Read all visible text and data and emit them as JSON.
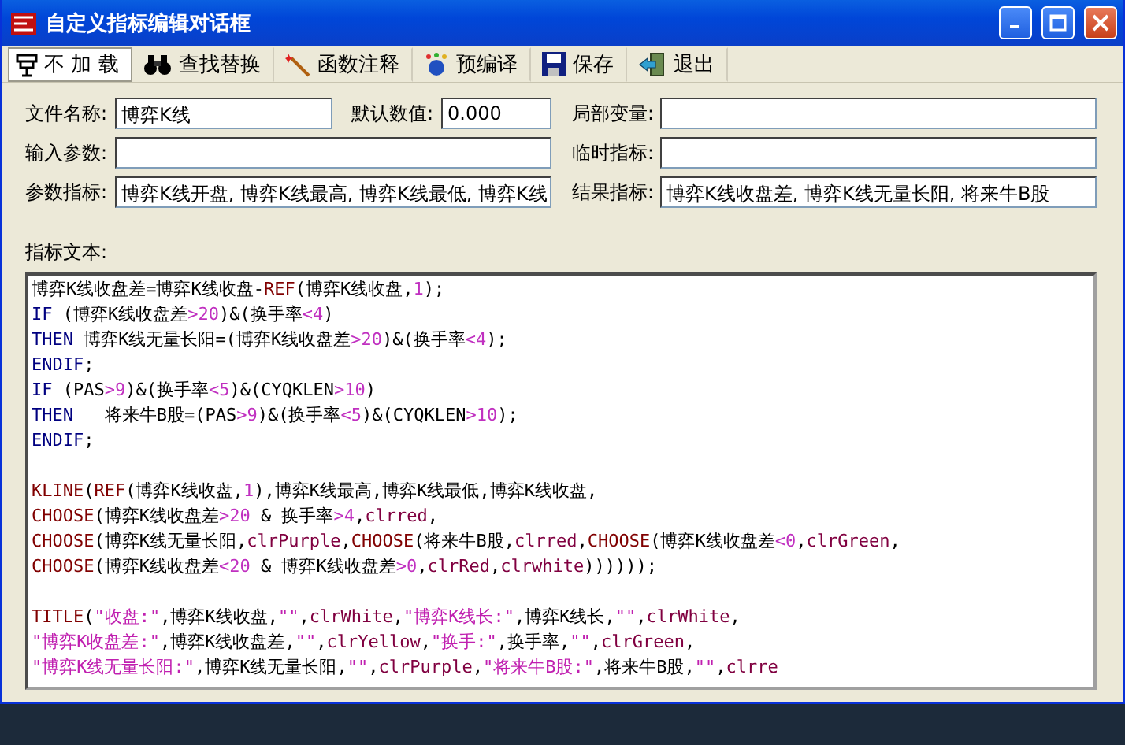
{
  "window": {
    "title": "自定义指标编辑对话框"
  },
  "toolbar": [
    {
      "label": "不 加 载",
      "pressed": true
    },
    {
      "label": "查找替换",
      "pressed": false
    },
    {
      "label": "函数注释",
      "pressed": false
    },
    {
      "label": "预编译",
      "pressed": false
    },
    {
      "label": "保存",
      "pressed": false
    },
    {
      "label": "退出",
      "pressed": false
    }
  ],
  "fields": {
    "file_name": {
      "label": "文件名称:",
      "value": "博弈K线"
    },
    "default_value": {
      "label": "默认数值:",
      "value": "0.000"
    },
    "local_vars": {
      "label": "局部变量:"
    },
    "input_params": {
      "label": "输入参数:"
    },
    "temp_indicators": {
      "label": "临时指标:"
    },
    "param_indicators": {
      "label": "参数指标:",
      "value": "博弈K线开盘, 博弈K线最高, 博弈K线最低, 博弈K线"
    },
    "result_indicators": {
      "label": "结果指标:",
      "value": "博弈K线收盘差, 博弈K线无量长阳, 将来牛B股"
    }
  },
  "editor": {
    "label": "指标文本:",
    "lines": [
      {
        "kind": "code",
        "segments": [
          {
            "kind": "text",
            "text": "博弈K线收盘差=博弈K线收盘-"
          },
          {
            "kind": "fn",
            "text": "REF"
          },
          {
            "kind": "text",
            "text": "(博弈K线收盘,"
          },
          {
            "kind": "num",
            "text": "1"
          },
          {
            "kind": "text",
            "text": ");"
          }
        ]
      },
      {
        "kind": "code",
        "segments": [
          {
            "kind": "kw",
            "text": "IF"
          },
          {
            "kind": "text",
            "text": " (博弈K线收盘差"
          },
          {
            "kind": "num",
            "text": ">20"
          },
          {
            "kind": "text",
            "text": ")&(换手率"
          },
          {
            "kind": "num",
            "text": "<4"
          },
          {
            "kind": "text",
            "text": ")"
          }
        ]
      },
      {
        "kind": "code",
        "segments": [
          {
            "kind": "kw",
            "text": "THEN"
          },
          {
            "kind": "text",
            "text": " 博弈K线无量长阳=(博弈K线收盘差"
          },
          {
            "kind": "num",
            "text": ">20"
          },
          {
            "kind": "text",
            "text": ")&(换手率"
          },
          {
            "kind": "num",
            "text": "<4"
          },
          {
            "kind": "text",
            "text": ");"
          }
        ]
      },
      {
        "kind": "code",
        "segments": [
          {
            "kind": "kw",
            "text": "ENDIF"
          },
          {
            "kind": "text",
            "text": ";"
          }
        ]
      },
      {
        "kind": "code",
        "segments": [
          {
            "kind": "kw",
            "text": "IF"
          },
          {
            "kind": "text",
            "text": " (PAS"
          },
          {
            "kind": "num",
            "text": ">9"
          },
          {
            "kind": "text",
            "text": ")&(换手率"
          },
          {
            "kind": "num",
            "text": "<5"
          },
          {
            "kind": "text",
            "text": ")&(CYQKLEN"
          },
          {
            "kind": "num",
            "text": ">10"
          },
          {
            "kind": "text",
            "text": ")"
          }
        ]
      },
      {
        "kind": "code",
        "segments": [
          {
            "kind": "kw",
            "text": "THEN"
          },
          {
            "kind": "text",
            "text": "   将来牛B股=(PAS"
          },
          {
            "kind": "num",
            "text": ">9"
          },
          {
            "kind": "text",
            "text": ")&(换手率"
          },
          {
            "kind": "num",
            "text": "<5"
          },
          {
            "kind": "text",
            "text": ")&(CYQKLEN"
          },
          {
            "kind": "num",
            "text": ">10"
          },
          {
            "kind": "text",
            "text": ");"
          }
        ]
      },
      {
        "kind": "code",
        "segments": [
          {
            "kind": "kw",
            "text": "ENDIF"
          },
          {
            "kind": "text",
            "text": ";"
          }
        ]
      },
      {
        "kind": "blank"
      },
      {
        "kind": "code",
        "segments": [
          {
            "kind": "fn",
            "text": "KLINE"
          },
          {
            "kind": "text",
            "text": "("
          },
          {
            "kind": "fn",
            "text": "REF"
          },
          {
            "kind": "text",
            "text": "(博弈K线收盘,"
          },
          {
            "kind": "num",
            "text": "1"
          },
          {
            "kind": "text",
            "text": "),博弈K线最高,博弈K线最低,博弈K线收盘,"
          }
        ]
      },
      {
        "kind": "code",
        "segments": [
          {
            "kind": "fn",
            "text": "CHOOSE"
          },
          {
            "kind": "text",
            "text": "(博弈K线收盘差"
          },
          {
            "kind": "num",
            "text": ">20"
          },
          {
            "kind": "text",
            "text": " & 换手率"
          },
          {
            "kind": "num",
            "text": ">4"
          },
          {
            "kind": "text",
            "text": ","
          },
          {
            "kind": "clr",
            "text": "clrred"
          },
          {
            "kind": "text",
            "text": ","
          }
        ]
      },
      {
        "kind": "code",
        "segments": [
          {
            "kind": "fn",
            "text": "CHOOSE"
          },
          {
            "kind": "text",
            "text": "(博弈K线无量长阳,"
          },
          {
            "kind": "clr",
            "text": "clrPurple"
          },
          {
            "kind": "text",
            "text": ","
          },
          {
            "kind": "fn",
            "text": "CHOOSE"
          },
          {
            "kind": "text",
            "text": "(将来牛B股,"
          },
          {
            "kind": "clr",
            "text": "clrred"
          },
          {
            "kind": "text",
            "text": ","
          },
          {
            "kind": "fn",
            "text": "CHOOSE"
          },
          {
            "kind": "text",
            "text": "(博弈K线收盘差"
          },
          {
            "kind": "num",
            "text": "<0"
          },
          {
            "kind": "text",
            "text": ","
          },
          {
            "kind": "clr",
            "text": "clrGreen"
          },
          {
            "kind": "text",
            "text": ","
          }
        ]
      },
      {
        "kind": "code",
        "segments": [
          {
            "kind": "fn",
            "text": "CHOOSE"
          },
          {
            "kind": "text",
            "text": "(博弈K线收盘差"
          },
          {
            "kind": "num",
            "text": "<20"
          },
          {
            "kind": "text",
            "text": " & 博弈K线收盘差"
          },
          {
            "kind": "num",
            "text": ">0"
          },
          {
            "kind": "text",
            "text": ","
          },
          {
            "kind": "clr",
            "text": "clrRed"
          },
          {
            "kind": "text",
            "text": ","
          },
          {
            "kind": "clr",
            "text": "clrwhite"
          },
          {
            "kind": "text",
            "text": "))))));"
          }
        ]
      },
      {
        "kind": "blank"
      },
      {
        "kind": "code",
        "segments": [
          {
            "kind": "fn",
            "text": "TITLE"
          },
          {
            "kind": "text",
            "text": "("
          },
          {
            "kind": "str",
            "text": "\"收盘:\""
          },
          {
            "kind": "text",
            "text": ",博弈K线收盘,"
          },
          {
            "kind": "str",
            "text": "\"\""
          },
          {
            "kind": "text",
            "text": ","
          },
          {
            "kind": "clr",
            "text": "clrWhite"
          },
          {
            "kind": "text",
            "text": ","
          },
          {
            "kind": "str",
            "text": "\"博弈K线长:\""
          },
          {
            "kind": "text",
            "text": ",博弈K线长,"
          },
          {
            "kind": "str",
            "text": "\"\""
          },
          {
            "kind": "text",
            "text": ","
          },
          {
            "kind": "clr",
            "text": "clrWhite"
          },
          {
            "kind": "text",
            "text": ","
          }
        ]
      },
      {
        "kind": "code",
        "segments": [
          {
            "kind": "str",
            "text": "\"博弈K收盘差:\""
          },
          {
            "kind": "text",
            "text": ",博弈K线收盘差,"
          },
          {
            "kind": "str",
            "text": "\"\""
          },
          {
            "kind": "text",
            "text": ","
          },
          {
            "kind": "clr",
            "text": "clrYellow"
          },
          {
            "kind": "text",
            "text": ","
          },
          {
            "kind": "str",
            "text": "\"换手:\""
          },
          {
            "kind": "text",
            "text": ",换手率,"
          },
          {
            "kind": "str",
            "text": "\"\""
          },
          {
            "kind": "text",
            "text": ","
          },
          {
            "kind": "clr",
            "text": "clrGreen"
          },
          {
            "kind": "text",
            "text": ","
          }
        ]
      },
      {
        "kind": "code",
        "segments": [
          {
            "kind": "str",
            "text": "\"博弈K线无量长阳:\""
          },
          {
            "kind": "text",
            "text": ",博弈K线无量长阳,"
          },
          {
            "kind": "str",
            "text": "\"\""
          },
          {
            "kind": "text",
            "text": ","
          },
          {
            "kind": "clr",
            "text": "clrPurple"
          },
          {
            "kind": "text",
            "text": ","
          },
          {
            "kind": "str",
            "text": "\"将来牛B股:\""
          },
          {
            "kind": "text",
            "text": ",将来牛B股,"
          },
          {
            "kind": "str",
            "text": "\"\""
          },
          {
            "kind": "text",
            "text": ","
          },
          {
            "kind": "clr",
            "text": "clrre"
          }
        ]
      }
    ]
  }
}
